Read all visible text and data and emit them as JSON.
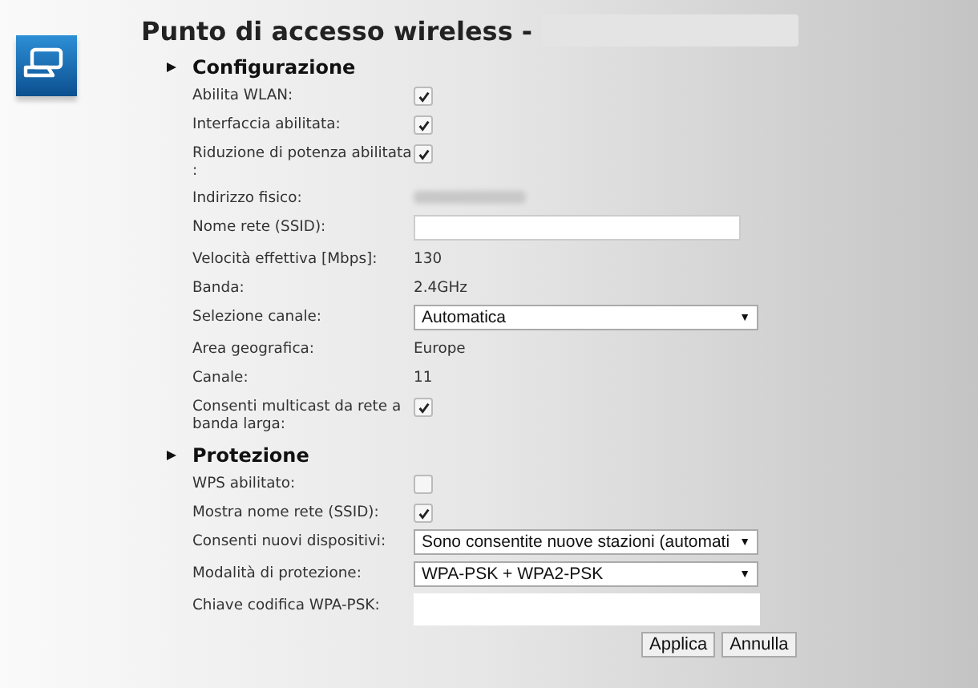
{
  "title": "Punto di accesso wireless -",
  "sections": [
    {
      "heading": "Configurazione",
      "rows": [
        {
          "kind": "checkbox",
          "label": "Abilita WLAN:",
          "checked": true
        },
        {
          "kind": "checkbox",
          "label": "Interfaccia abilitata:",
          "checked": true
        },
        {
          "kind": "checkbox",
          "label": "Riduzione di potenza abilitata :",
          "checked": true
        },
        {
          "kind": "blurred",
          "label": "Indirizzo fisico:"
        },
        {
          "kind": "input",
          "label": "Nome rete (SSID):"
        },
        {
          "kind": "text",
          "label": "Velocità effettiva [Mbps]:",
          "value": "130"
        },
        {
          "kind": "text",
          "label": "Banda:",
          "value": "2.4GHz"
        },
        {
          "kind": "select",
          "label": "Selezione canale:",
          "value": "Automatica",
          "arrow": "▼"
        },
        {
          "kind": "text",
          "label": "Area geografica:",
          "value": "Europe"
        },
        {
          "kind": "text",
          "label": "Canale:",
          "value": "11"
        },
        {
          "kind": "checkbox",
          "label": "Consenti multicast da rete a banda larga:",
          "checked": true
        }
      ]
    },
    {
      "heading": "Protezione",
      "rows": [
        {
          "kind": "checkbox",
          "label": "WPS abilitato:",
          "checked": false
        },
        {
          "kind": "checkbox",
          "label": "Mostra nome rete (SSID):",
          "checked": true
        },
        {
          "kind": "select",
          "label": "Consenti nuovi dispositivi:",
          "value": "Sono consentite nuove stazioni (automati",
          "arrow": "▼"
        },
        {
          "kind": "select",
          "label": "Modalità di protezione:",
          "value": "WPA-PSK + WPA2-PSK",
          "arrow": "▼"
        },
        {
          "kind": "input",
          "label": "Chiave codifica WPA-PSK:"
        }
      ]
    }
  ],
  "buttons": [
    "Applica",
    "Annulla"
  ]
}
